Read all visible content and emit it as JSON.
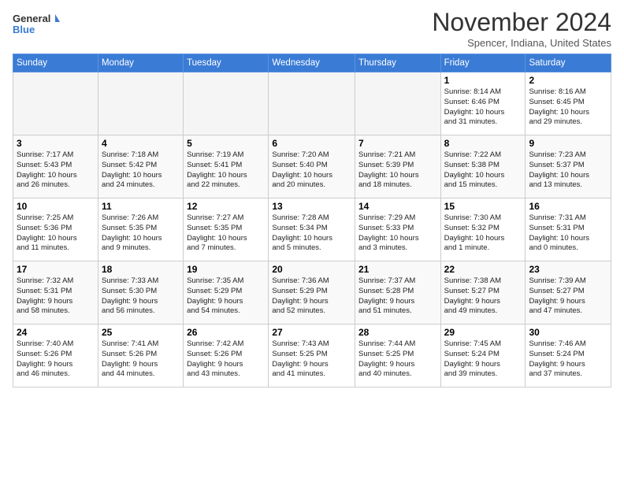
{
  "header": {
    "logo_line1": "General",
    "logo_line2": "Blue",
    "month": "November 2024",
    "location": "Spencer, Indiana, United States"
  },
  "weekdays": [
    "Sunday",
    "Monday",
    "Tuesday",
    "Wednesday",
    "Thursday",
    "Friday",
    "Saturday"
  ],
  "weeks": [
    [
      {
        "day": "",
        "info": ""
      },
      {
        "day": "",
        "info": ""
      },
      {
        "day": "",
        "info": ""
      },
      {
        "day": "",
        "info": ""
      },
      {
        "day": "",
        "info": ""
      },
      {
        "day": "1",
        "info": "Sunrise: 8:14 AM\nSunset: 6:46 PM\nDaylight: 10 hours\nand 31 minutes."
      },
      {
        "day": "2",
        "info": "Sunrise: 8:16 AM\nSunset: 6:45 PM\nDaylight: 10 hours\nand 29 minutes."
      }
    ],
    [
      {
        "day": "3",
        "info": "Sunrise: 7:17 AM\nSunset: 5:43 PM\nDaylight: 10 hours\nand 26 minutes."
      },
      {
        "day": "4",
        "info": "Sunrise: 7:18 AM\nSunset: 5:42 PM\nDaylight: 10 hours\nand 24 minutes."
      },
      {
        "day": "5",
        "info": "Sunrise: 7:19 AM\nSunset: 5:41 PM\nDaylight: 10 hours\nand 22 minutes."
      },
      {
        "day": "6",
        "info": "Sunrise: 7:20 AM\nSunset: 5:40 PM\nDaylight: 10 hours\nand 20 minutes."
      },
      {
        "day": "7",
        "info": "Sunrise: 7:21 AM\nSunset: 5:39 PM\nDaylight: 10 hours\nand 18 minutes."
      },
      {
        "day": "8",
        "info": "Sunrise: 7:22 AM\nSunset: 5:38 PM\nDaylight: 10 hours\nand 15 minutes."
      },
      {
        "day": "9",
        "info": "Sunrise: 7:23 AM\nSunset: 5:37 PM\nDaylight: 10 hours\nand 13 minutes."
      }
    ],
    [
      {
        "day": "10",
        "info": "Sunrise: 7:25 AM\nSunset: 5:36 PM\nDaylight: 10 hours\nand 11 minutes."
      },
      {
        "day": "11",
        "info": "Sunrise: 7:26 AM\nSunset: 5:35 PM\nDaylight: 10 hours\nand 9 minutes."
      },
      {
        "day": "12",
        "info": "Sunrise: 7:27 AM\nSunset: 5:35 PM\nDaylight: 10 hours\nand 7 minutes."
      },
      {
        "day": "13",
        "info": "Sunrise: 7:28 AM\nSunset: 5:34 PM\nDaylight: 10 hours\nand 5 minutes."
      },
      {
        "day": "14",
        "info": "Sunrise: 7:29 AM\nSunset: 5:33 PM\nDaylight: 10 hours\nand 3 minutes."
      },
      {
        "day": "15",
        "info": "Sunrise: 7:30 AM\nSunset: 5:32 PM\nDaylight: 10 hours\nand 1 minute."
      },
      {
        "day": "16",
        "info": "Sunrise: 7:31 AM\nSunset: 5:31 PM\nDaylight: 10 hours\nand 0 minutes."
      }
    ],
    [
      {
        "day": "17",
        "info": "Sunrise: 7:32 AM\nSunset: 5:31 PM\nDaylight: 9 hours\nand 58 minutes."
      },
      {
        "day": "18",
        "info": "Sunrise: 7:33 AM\nSunset: 5:30 PM\nDaylight: 9 hours\nand 56 minutes."
      },
      {
        "day": "19",
        "info": "Sunrise: 7:35 AM\nSunset: 5:29 PM\nDaylight: 9 hours\nand 54 minutes."
      },
      {
        "day": "20",
        "info": "Sunrise: 7:36 AM\nSunset: 5:29 PM\nDaylight: 9 hours\nand 52 minutes."
      },
      {
        "day": "21",
        "info": "Sunrise: 7:37 AM\nSunset: 5:28 PM\nDaylight: 9 hours\nand 51 minutes."
      },
      {
        "day": "22",
        "info": "Sunrise: 7:38 AM\nSunset: 5:27 PM\nDaylight: 9 hours\nand 49 minutes."
      },
      {
        "day": "23",
        "info": "Sunrise: 7:39 AM\nSunset: 5:27 PM\nDaylight: 9 hours\nand 47 minutes."
      }
    ],
    [
      {
        "day": "24",
        "info": "Sunrise: 7:40 AM\nSunset: 5:26 PM\nDaylight: 9 hours\nand 46 minutes."
      },
      {
        "day": "25",
        "info": "Sunrise: 7:41 AM\nSunset: 5:26 PM\nDaylight: 9 hours\nand 44 minutes."
      },
      {
        "day": "26",
        "info": "Sunrise: 7:42 AM\nSunset: 5:26 PM\nDaylight: 9 hours\nand 43 minutes."
      },
      {
        "day": "27",
        "info": "Sunrise: 7:43 AM\nSunset: 5:25 PM\nDaylight: 9 hours\nand 41 minutes."
      },
      {
        "day": "28",
        "info": "Sunrise: 7:44 AM\nSunset: 5:25 PM\nDaylight: 9 hours\nand 40 minutes."
      },
      {
        "day": "29",
        "info": "Sunrise: 7:45 AM\nSunset: 5:24 PM\nDaylight: 9 hours\nand 39 minutes."
      },
      {
        "day": "30",
        "info": "Sunrise: 7:46 AM\nSunset: 5:24 PM\nDaylight: 9 hours\nand 37 minutes."
      }
    ]
  ]
}
